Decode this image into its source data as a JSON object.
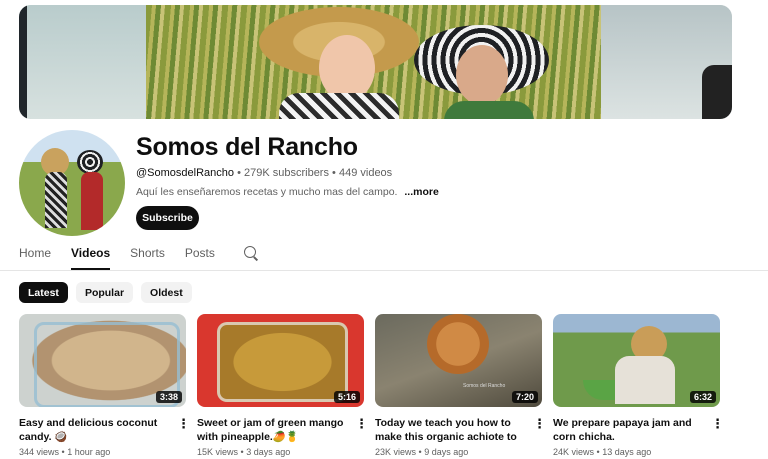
{
  "channel": {
    "name": "Somos del Rancho",
    "handle": "@SomosdelRancho",
    "subscribers": "279K subscribers",
    "videos_count": "449 videos",
    "separator": "•",
    "description": "Aquí les enseñaremos recetas y mucho mas del campo.",
    "more_label": "...more",
    "subscribe_label": "Subscribe"
  },
  "tabs": [
    {
      "label": "Home"
    },
    {
      "label": "Videos",
      "active": true
    },
    {
      "label": "Shorts"
    },
    {
      "label": "Posts"
    }
  ],
  "chips": [
    {
      "label": "Latest",
      "selected": true
    },
    {
      "label": "Popular"
    },
    {
      "label": "Oldest"
    }
  ],
  "videos": [
    {
      "title": "Easy and delicious coconut candy. 🥥",
      "duration": "3:38",
      "views": "344 views",
      "age": "1 hour ago"
    },
    {
      "title": "Sweet or jam of green mango with pineapple.🥭🍍",
      "duration": "5:16",
      "views": "15K views",
      "age": "3 days ago"
    },
    {
      "title": "Today we teach you how to make this organic achiote to add color to...",
      "duration": "7:20",
      "views": "23K views",
      "age": "9 days ago"
    },
    {
      "title": "We prepare papaya jam and corn chicha.",
      "duration": "6:32",
      "views": "24K views",
      "age": "13 days ago"
    }
  ],
  "kebab_glyph": "⋮",
  "colors": {
    "primary_text": "#0f0f0f",
    "secondary_text": "#606060",
    "chip_bg": "#f2f2f2",
    "button_bg": "#0f0f0f"
  }
}
